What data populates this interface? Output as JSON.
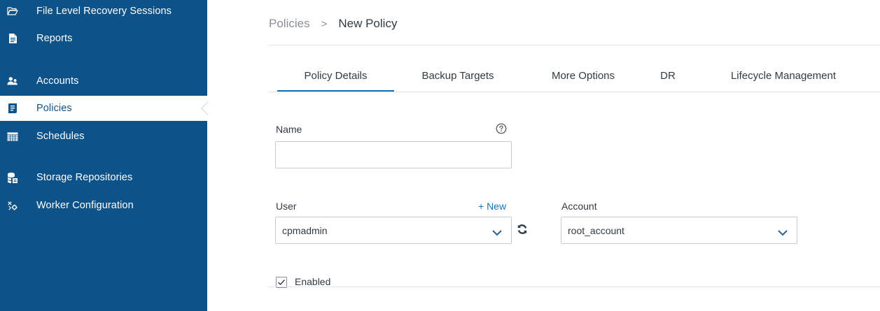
{
  "sidebar": {
    "items": [
      {
        "label": "File Level Recovery Sessions",
        "icon": "folder-open-icon"
      },
      {
        "label": "Reports",
        "icon": "document-icon"
      },
      {
        "label": "Accounts",
        "icon": "users-icon"
      },
      {
        "label": "Policies",
        "icon": "policy-icon",
        "active": true
      },
      {
        "label": "Schedules",
        "icon": "calendar-grid-icon"
      },
      {
        "label": "Storage Repositories",
        "icon": "database-icon"
      },
      {
        "label": "Worker Configuration",
        "icon": "worker-config-icon"
      }
    ]
  },
  "breadcrumb": {
    "parent": "Policies",
    "separator": ">",
    "current": "New Policy"
  },
  "tabs": [
    {
      "label": "Policy Details",
      "active": true
    },
    {
      "label": "Backup Targets"
    },
    {
      "label": "More Options"
    },
    {
      "label": "DR"
    },
    {
      "label": "Lifecycle Management"
    }
  ],
  "form": {
    "name_label": "Name",
    "name_value": "",
    "user_label": "User",
    "user_new_link": "+ New",
    "user_value": "cpmadmin",
    "account_label": "Account",
    "account_value": "root_account",
    "enabled_label": "Enabled",
    "enabled_checked": true
  },
  "colors": {
    "sidebar_bg": "#0d5288",
    "accent": "#1173b6",
    "text": "#333a41",
    "muted": "#8a8f96"
  }
}
